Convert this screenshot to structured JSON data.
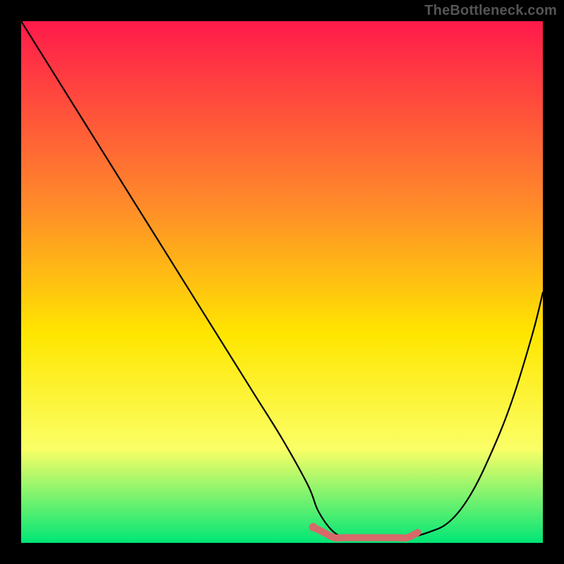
{
  "watermark": "TheBottleneck.com",
  "colors": {
    "background": "#000000",
    "gradient_top": "#ff1a4b",
    "gradient_mid1": "#ff8a2a",
    "gradient_mid2": "#ffe600",
    "gradient_mid3": "#fbff66",
    "gradient_bottom": "#00e676",
    "curve": "#000000",
    "highlight": "#d66a6a"
  },
  "chart_data": {
    "type": "line",
    "title": "",
    "xlabel": "",
    "ylabel": "",
    "xlim": [
      0,
      100
    ],
    "ylim": [
      0,
      100
    ],
    "grid": false,
    "legend_position": "none",
    "series": [
      {
        "name": "bottleneck_curve",
        "x": [
          0,
          5,
          10,
          15,
          20,
          25,
          30,
          35,
          40,
          45,
          50,
          55,
          57,
          60,
          63,
          66,
          70,
          74,
          78,
          82,
          86,
          90,
          94,
          98,
          100
        ],
        "values": [
          100,
          92,
          84,
          76,
          68,
          60,
          52,
          44,
          36,
          28,
          20,
          11,
          6,
          2,
          1,
          1,
          1,
          1,
          2,
          4,
          9,
          17,
          27,
          40,
          48
        ]
      }
    ],
    "highlight_segment": {
      "name": "optimal_range",
      "x": [
        56,
        58,
        60,
        62,
        64,
        66,
        68,
        70,
        72,
        74,
        76
      ],
      "values": [
        3,
        2,
        1,
        1,
        1,
        1,
        1,
        1,
        1,
        1,
        2
      ]
    },
    "annotations": []
  }
}
